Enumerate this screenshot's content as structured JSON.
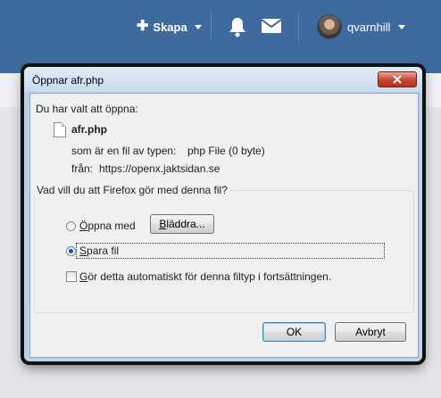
{
  "topbar": {
    "create_label": "Skapa",
    "username": "qvarnhill"
  },
  "dialog": {
    "title": "Öppnar afr.php",
    "intro": "Du har valt att öppna:",
    "filename": "afr.php",
    "type_label": "som är en fil av typen:",
    "type_value": "php File (0 byte)",
    "from_label": "från:",
    "from_value": "https://openx.jaktsidan.se",
    "question": "Vad vill du att Firefox gör med denna fil?",
    "open_with": {
      "accesskey": "Ö",
      "rest": "ppna med",
      "selected": false
    },
    "browse_button": {
      "accesskey": "B",
      "rest": "läddra..."
    },
    "save_file": {
      "accesskey": "S",
      "rest": "para fil",
      "selected": true
    },
    "auto_checkbox": {
      "accesskey": "G",
      "rest": "ör detta automatiskt för denna filtyp i fortsättningen.",
      "checked": false
    },
    "ok_label": "OK",
    "cancel_label": "Avbryt"
  }
}
